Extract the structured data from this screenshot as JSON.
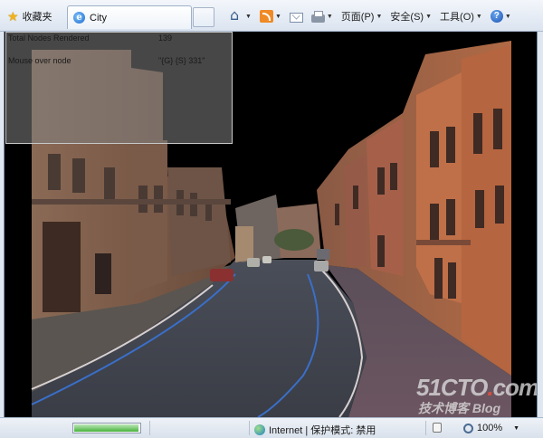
{
  "toolbar": {
    "favorites_label": "收藏夹",
    "tab_title": "City",
    "menus": [
      {
        "name": "home",
        "label": ""
      },
      {
        "name": "feeds",
        "label": ""
      },
      {
        "name": "mail",
        "label": ""
      },
      {
        "name": "print",
        "label": ""
      },
      {
        "name": "page",
        "label": "页面(P)"
      },
      {
        "name": "safety",
        "label": "安全(S)"
      },
      {
        "name": "tools",
        "label": "工具(O)"
      },
      {
        "name": "help",
        "label": ""
      }
    ]
  },
  "hud": {
    "rows": [
      {
        "label": "Total Nodes Rendered",
        "value": "139"
      },
      {
        "label": "Mouse over node",
        "value": "\"{G} {S} 331\""
      }
    ]
  },
  "watermark": {
    "line1_a": "51CTO",
    "line1_dot": ".",
    "line1_b": "com",
    "line2": "技术博客  Blog"
  },
  "status": {
    "progress": 0.98,
    "zone": "Internet | 保护模式: 禁用",
    "zoom": "100%"
  },
  "colors": {
    "sky": "#000000",
    "hud_bg": "#828282",
    "accent_blue": "#3a6fc9"
  }
}
